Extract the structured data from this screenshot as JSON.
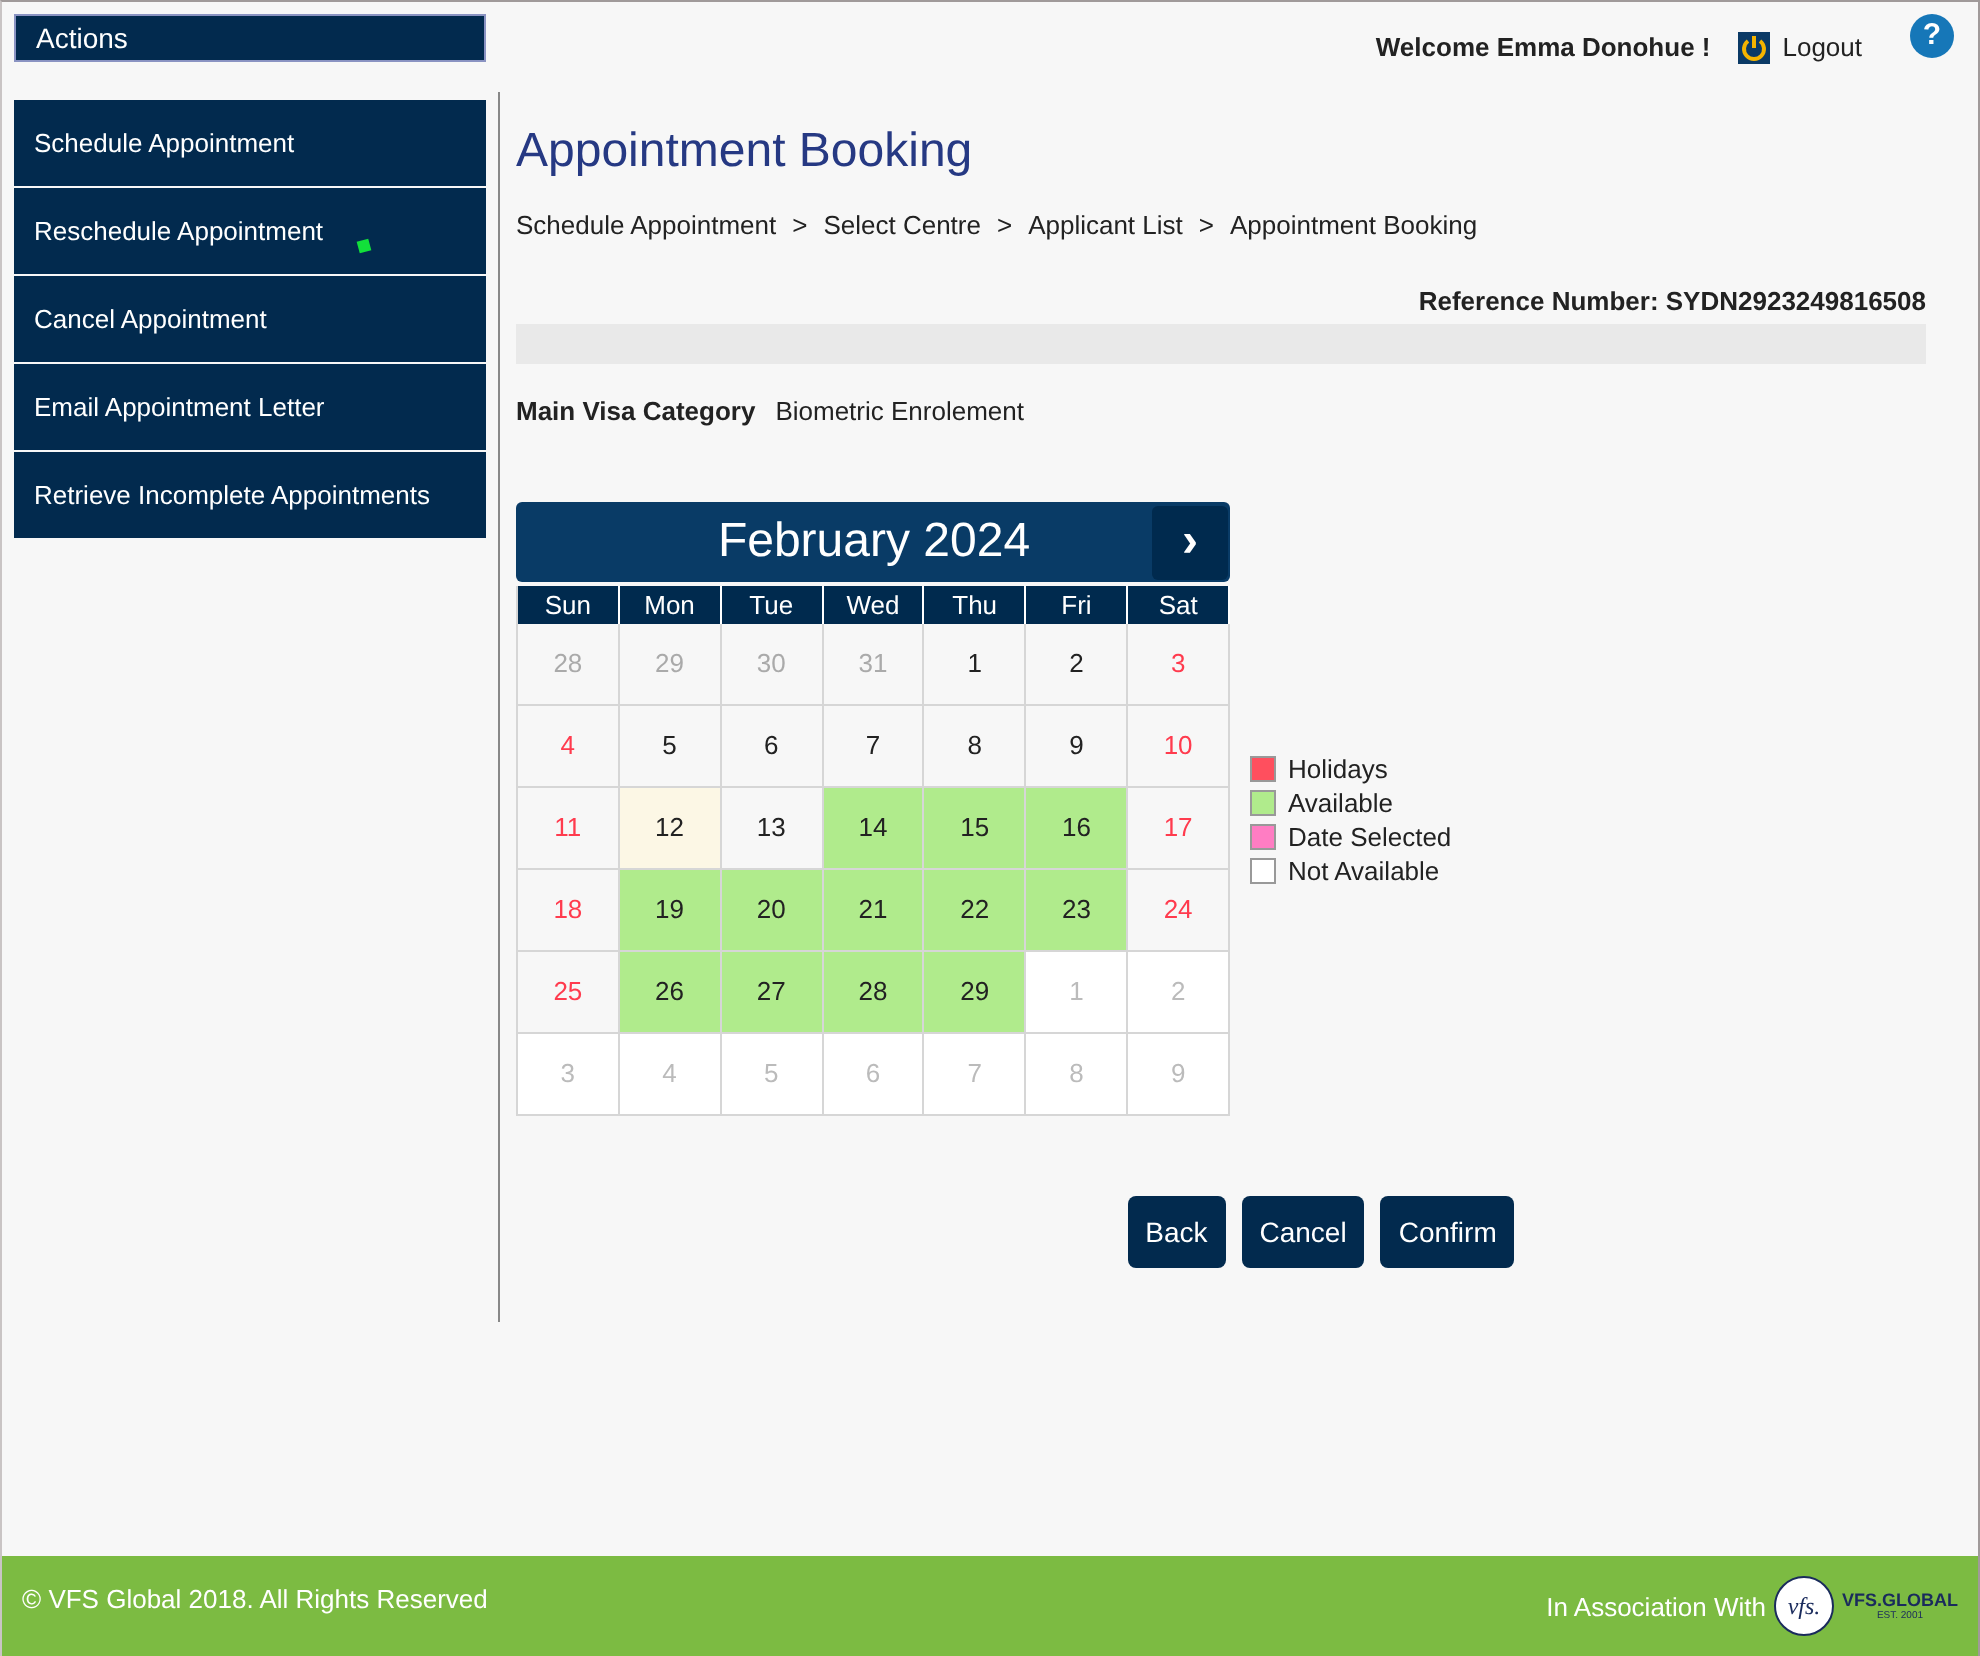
{
  "sidebar": {
    "title": "Actions",
    "items": [
      {
        "label": "Schedule Appointment",
        "marker": false
      },
      {
        "label": "Reschedule Appointment",
        "marker": true
      },
      {
        "label": "Cancel Appointment",
        "marker": false
      },
      {
        "label": "Email Appointment Letter",
        "marker": false
      },
      {
        "label": "Retrieve Incomplete Appointments",
        "marker": false
      }
    ]
  },
  "header": {
    "welcome": "Welcome Emma Donohue !",
    "logout": "Logout",
    "help": "?"
  },
  "page_title": "Appointment Booking",
  "breadcrumb": [
    "Schedule Appointment",
    "Select Centre",
    "Applicant List",
    "Appointment Booking"
  ],
  "breadcrumb_separator": ">",
  "reference": "Reference Number: SYDN2923249816508",
  "visa_category": {
    "label": "Main Visa Category",
    "value": "Biometric Enrolement"
  },
  "calendar": {
    "month": "February 2024",
    "next": "›",
    "weekdays": [
      "Sun",
      "Mon",
      "Tue",
      "Wed",
      "Thu",
      "Fri",
      "Sat"
    ],
    "weeks": [
      [
        {
          "day": "28",
          "kind": "past"
        },
        {
          "day": "29",
          "kind": "past"
        },
        {
          "day": "30",
          "kind": "past"
        },
        {
          "day": "31",
          "kind": "past"
        },
        {
          "day": "1",
          "kind": "normal"
        },
        {
          "day": "2",
          "kind": "normal"
        },
        {
          "day": "3",
          "kind": "weekend"
        }
      ],
      [
        {
          "day": "4",
          "kind": "weekend"
        },
        {
          "day": "5",
          "kind": "normal"
        },
        {
          "day": "6",
          "kind": "normal"
        },
        {
          "day": "7",
          "kind": "normal"
        },
        {
          "day": "8",
          "kind": "normal"
        },
        {
          "day": "9",
          "kind": "normal"
        },
        {
          "day": "10",
          "kind": "weekend"
        }
      ],
      [
        {
          "day": "11",
          "kind": "weekend"
        },
        {
          "day": "12",
          "kind": "today"
        },
        {
          "day": "13",
          "kind": "normal"
        },
        {
          "day": "14",
          "kind": "available"
        },
        {
          "day": "15",
          "kind": "available"
        },
        {
          "day": "16",
          "kind": "available"
        },
        {
          "day": "17",
          "kind": "weekend"
        }
      ],
      [
        {
          "day": "18",
          "kind": "weekend"
        },
        {
          "day": "19",
          "kind": "available"
        },
        {
          "day": "20",
          "kind": "available"
        },
        {
          "day": "21",
          "kind": "available"
        },
        {
          "day": "22",
          "kind": "available"
        },
        {
          "day": "23",
          "kind": "available"
        },
        {
          "day": "24",
          "kind": "weekend"
        }
      ],
      [
        {
          "day": "25",
          "kind": "weekend"
        },
        {
          "day": "26",
          "kind": "available"
        },
        {
          "day": "27",
          "kind": "available"
        },
        {
          "day": "28",
          "kind": "available"
        },
        {
          "day": "29",
          "kind": "available"
        },
        {
          "day": "1",
          "kind": "next"
        },
        {
          "day": "2",
          "kind": "next"
        }
      ],
      [
        {
          "day": "3",
          "kind": "next"
        },
        {
          "day": "4",
          "kind": "next"
        },
        {
          "day": "5",
          "kind": "next"
        },
        {
          "day": "6",
          "kind": "next"
        },
        {
          "day": "7",
          "kind": "next"
        },
        {
          "day": "8",
          "kind": "next"
        },
        {
          "day": "9",
          "kind": "next"
        }
      ]
    ]
  },
  "legend": [
    {
      "label": "Holidays",
      "color": "#ff4f5e"
    },
    {
      "label": "Available",
      "color": "#b0eb8c"
    },
    {
      "label": "Date Selected",
      "color": "#ff7dc3"
    },
    {
      "label": "Not Available",
      "color": "#ffffff"
    }
  ],
  "buttons": [
    "Back",
    "Cancel",
    "Confirm"
  ],
  "footer": {
    "copyright": "© VFS Global 2018. All Rights Reserved",
    "association": "In Association With",
    "logo_mark": "vfs.",
    "logo_name": "VFS.GLOBAL",
    "logo_est": "EST. 2001"
  }
}
